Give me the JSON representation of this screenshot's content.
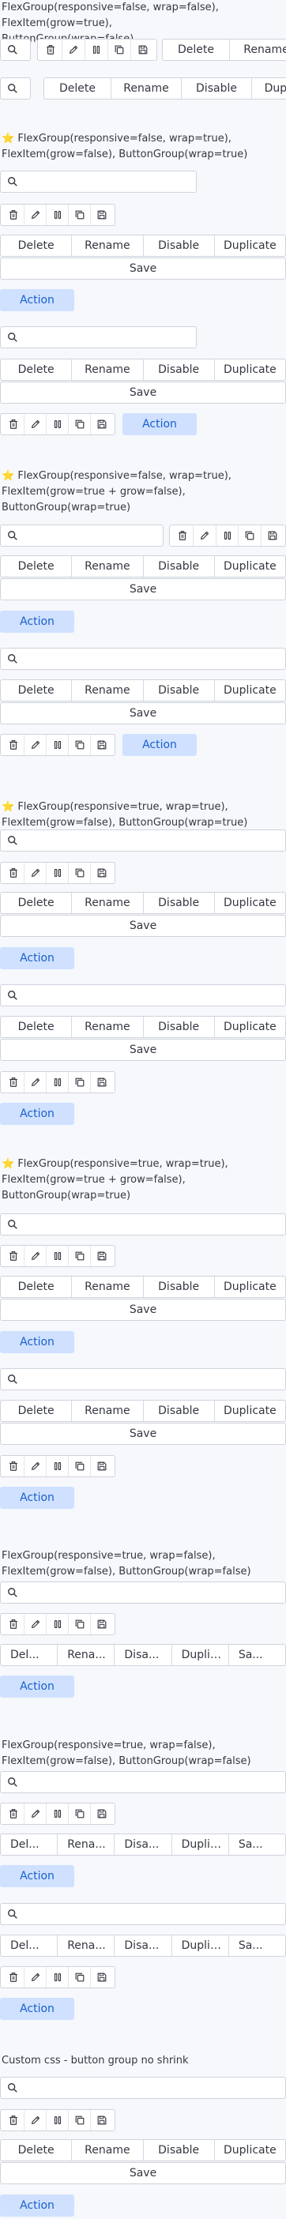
{
  "icons": {
    "search": "magnifier-icon",
    "row": [
      "trash-icon",
      "pencil-icon",
      "pause-icon",
      "copy-icon",
      "save-icon"
    ]
  },
  "buttons": {
    "delete": "Delete",
    "rename": "Rename",
    "disable": "Disable",
    "duplicate": "Duplicate",
    "save": "Save",
    "action": "Action"
  },
  "truncated": {
    "delete": "Del...",
    "rename": "Rena...",
    "disable": "Disa...",
    "duplicate": "Duplic...",
    "save": "Sa..."
  },
  "sections": {
    "s1": {
      "caption": "FlexGroup(responsive=false, wrap=false), FlexItem(grow=true), ButtonGroup(wrap=false)"
    },
    "s2": {
      "caption": "⭐ FlexGroup(responsive=false, wrap=true), FlexItem(grow=false), ButtonGroup(wrap=true)"
    },
    "s3": {
      "caption": "⭐ FlexGroup(responsive=false, wrap=true), FlexItem(grow=true + grow=false), ButtonGroup(wrap=true)"
    },
    "s4": {
      "caption": "⭐ FlexGroup(responsive=true, wrap=true), FlexItem(grow=false), ButtonGroup(wrap=true)"
    },
    "s5": {
      "caption": "⭐ FlexGroup(responsive=true, wrap=true), FlexItem(grow=true + grow=false), ButtonGroup(wrap=true)"
    },
    "s6": {
      "caption": "FlexGroup(responsive=true, wrap=false), FlexItem(grow=false), ButtonGroup(wrap=false)"
    },
    "s7": {
      "caption": "FlexGroup(responsive=true, wrap=false), FlexItem(grow=false), ButtonGroup(wrap=false)"
    },
    "s8": {
      "caption": "Custom css - button group no shrink"
    }
  }
}
